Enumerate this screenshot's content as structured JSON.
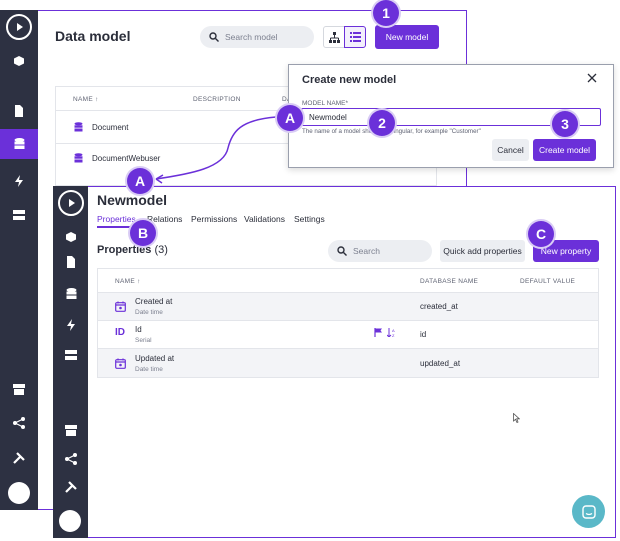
{
  "back_window": {
    "title": "Data model",
    "search_placeholder": "Search model",
    "new_model_label": "New model",
    "columns": {
      "name": "NAME",
      "description": "DESCRIPTION",
      "date": "DA"
    },
    "rows": [
      {
        "name": "Document"
      },
      {
        "name": "DocumentWebuser"
      }
    ]
  },
  "dialog": {
    "title": "Create new model",
    "field_label": "MODEL NAME*",
    "field_value": "Newmodel",
    "hint": "The name of a model should be singular, for example \"Customer\"",
    "cancel_label": "Cancel",
    "create_label": "Create model"
  },
  "front_window": {
    "title": "Newmodel",
    "tabs": [
      "Properties",
      "Relations",
      "Permissions",
      "Validations",
      "Settings"
    ],
    "section_title": "Properties",
    "section_count": "(3)",
    "search_placeholder": "Search",
    "quick_add_label": "Quick add properties",
    "new_property_label": "New property",
    "columns": {
      "name": "NAME",
      "database_name": "DATABASE NAME",
      "default_value": "DEFAULT VALUE"
    },
    "rows": [
      {
        "name": "Created at",
        "type": "Date time",
        "db": "created_at",
        "icon": "calendar-icon"
      },
      {
        "name": "Id",
        "type": "Serial",
        "db": "id",
        "icon_text": "ID"
      },
      {
        "name": "Updated at",
        "type": "Date time",
        "db": "updated_at",
        "icon": "calendar-icon"
      }
    ]
  },
  "callouts": {
    "one": "1",
    "two": "2",
    "three": "3",
    "a1": "A",
    "a2": "A",
    "b": "B",
    "c": "C"
  },
  "colors": {
    "accent": "#6b30d9",
    "sidebar": "#2d3142",
    "chat": "#5ab8c8"
  }
}
